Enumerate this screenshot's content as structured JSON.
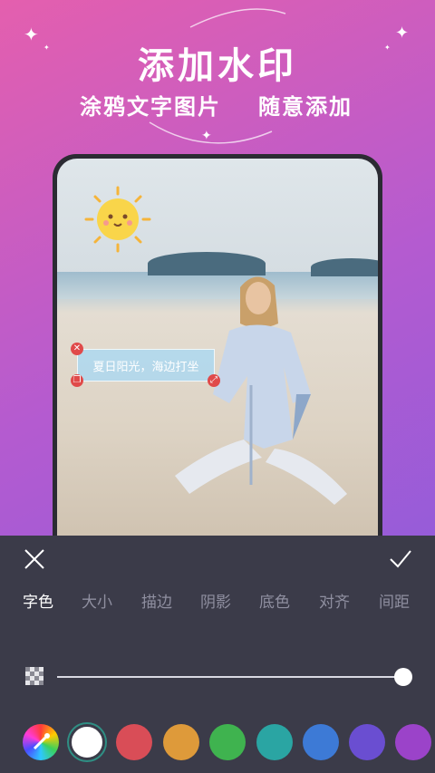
{
  "promo": {
    "headline": "添加水印",
    "subline_left": "涂鸦文字图片",
    "subline_right": "随意添加"
  },
  "photo": {
    "watermark_text": "夏日阳光，海边打坐"
  },
  "editor": {
    "tabs": [
      {
        "label": "字色",
        "active": true
      },
      {
        "label": "大小",
        "active": false
      },
      {
        "label": "描边",
        "active": false
      },
      {
        "label": "阴影",
        "active": false
      },
      {
        "label": "底色",
        "active": false
      },
      {
        "label": "对齐",
        "active": false
      },
      {
        "label": "间距",
        "active": false
      }
    ],
    "opacity": 1.0,
    "colors": [
      {
        "name": "color-picker",
        "value": "conic"
      },
      {
        "name": "white",
        "value": "#ffffff",
        "selected": true
      },
      {
        "name": "red",
        "value": "#d94d57"
      },
      {
        "name": "orange",
        "value": "#de9a3a"
      },
      {
        "name": "green",
        "value": "#3fb34f"
      },
      {
        "name": "teal",
        "value": "#2aa5a3"
      },
      {
        "name": "blue",
        "value": "#3d7ad6"
      },
      {
        "name": "indigo",
        "value": "#6a4ed1"
      },
      {
        "name": "purple",
        "value": "#9b43c9"
      }
    ]
  }
}
